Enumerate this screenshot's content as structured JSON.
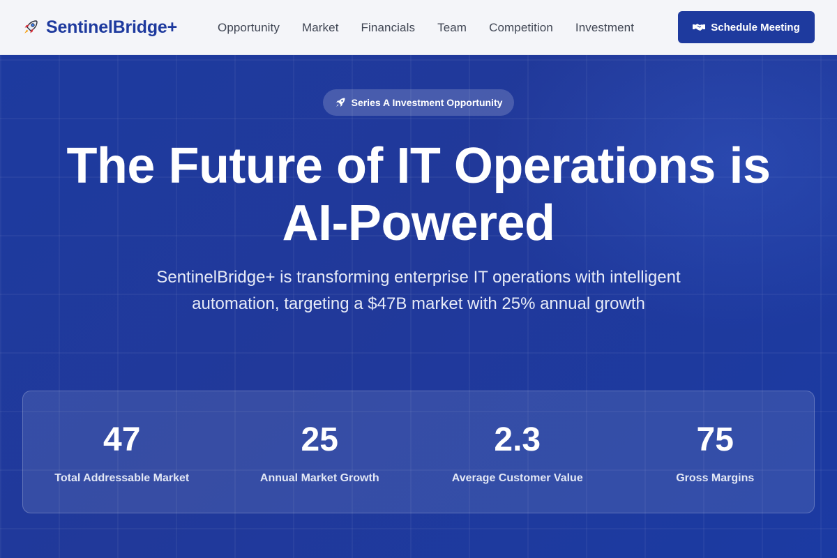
{
  "brand": {
    "name": "SentinelBridge+",
    "icon": "rocket-icon",
    "color": "#1e3a9e"
  },
  "nav": {
    "items": [
      {
        "label": "Opportunity"
      },
      {
        "label": "Market"
      },
      {
        "label": "Financials"
      },
      {
        "label": "Team"
      },
      {
        "label": "Competition"
      },
      {
        "label": "Investment"
      }
    ]
  },
  "header": {
    "cta_label": "Schedule Meeting",
    "cta_icon": "handshake-icon"
  },
  "hero": {
    "badge_label": "Series A Investment Opportunity",
    "badge_icon": "rocket-icon",
    "headline_line1": "The Future of IT Operations is",
    "headline_line2": "AI-Powered",
    "subtext": "SentinelBridge+ is transforming enterprise IT operations with intelligent automation, targeting a $47B market with 25% annual growth",
    "background_color": "#1e3a9e"
  },
  "stats": [
    {
      "value": "47",
      "label": "Total Addressable Market"
    },
    {
      "value": "25",
      "label": "Annual Market Growth"
    },
    {
      "value": "2.3",
      "label": "Average Customer Value"
    },
    {
      "value": "75",
      "label": "Gross Margins"
    }
  ]
}
